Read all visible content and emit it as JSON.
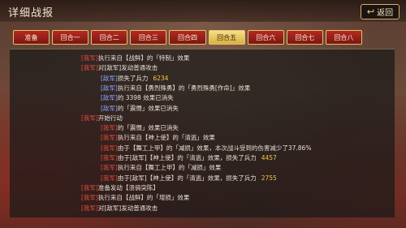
{
  "header": {
    "title": "详细战报",
    "back_label": "返回",
    "back_icon": "return-icon"
  },
  "tabs": [
    {
      "label": "准备",
      "active": false
    },
    {
      "label": "回合一",
      "active": false
    },
    {
      "label": "回合二",
      "active": false
    },
    {
      "label": "回合三",
      "active": false
    },
    {
      "label": "回合四",
      "active": false
    },
    {
      "label": "回合五",
      "active": true
    },
    {
      "label": "回合六",
      "active": false
    },
    {
      "label": "回合七",
      "active": false
    },
    {
      "label": "回合八",
      "active": false
    }
  ],
  "log": [
    {
      "indent": 0,
      "tag": "[我军]",
      "text": "执行来自【战鲜】的「特制」效果"
    },
    {
      "indent": 0,
      "tag": "[我军]",
      "text": "对[敌军]发动普通攻击"
    },
    {
      "indent": 1,
      "tag": "[敌军]",
      "text": "损失了兵力",
      "value": "6234"
    },
    {
      "indent": 1,
      "tag": "[敌军]",
      "text": "执行来自【勇烈殊勇】的「勇烈殊勇[作命]」效果"
    },
    {
      "indent": 1,
      "tag": "[敌军]",
      "text": "的 3398 效果已消失"
    },
    {
      "indent": 1,
      "tag": "[敌军]",
      "text": "的「震慑」效果已消失"
    },
    {
      "indent": 0,
      "tag": "[我军]",
      "text": "开始行动"
    },
    {
      "indent": 1,
      "tag": "[我军]",
      "text": "的「震慑」效果已消失"
    },
    {
      "indent": 1,
      "tag": "[我军]",
      "text": "执行来自【神上使】的「清逃」效果"
    },
    {
      "indent": 1,
      "tag": "[我军]",
      "text": "由于【舞工上甲】的「减损」效果，本次战斗受到的伤害减少了37.86%"
    },
    {
      "indent": 1,
      "tag": "[我军]",
      "text": "由于[敌军]【神上使】的「清逃」效果，损失了兵力",
      "value": "4457"
    },
    {
      "indent": 1,
      "tag": "[我军]",
      "text": "执行来自【舞工上甲】的「减损」效果"
    },
    {
      "indent": 1,
      "tag": "[我军]",
      "text": "由于[敌军]【神上使】的「清逃」效果，损失了兵力",
      "value": "2755"
    },
    {
      "indent": 0,
      "tag": "[我军]",
      "text": "准备发动【溃骑突陈】"
    },
    {
      "indent": 0,
      "tag": "[我军]",
      "text": "执行来自【战鲜】的「增损」效果"
    },
    {
      "indent": 0,
      "tag": "[我军]",
      "text": "对[敌军]发动普通攻击"
    }
  ],
  "colors": {
    "accent_red": "#b52a22",
    "tab_active": "#e7c26a",
    "text_red": "#e04a3a"
  }
}
